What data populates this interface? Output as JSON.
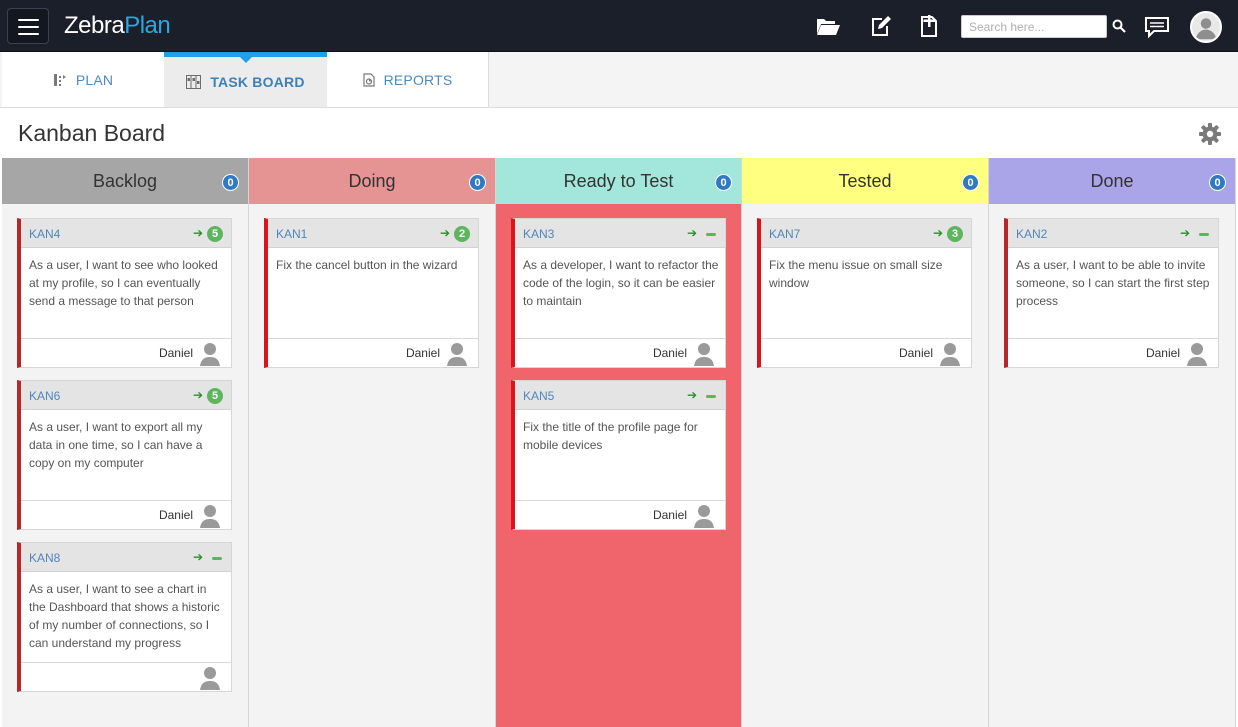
{
  "app": {
    "logo_main": "Zebra",
    "logo_accent": "Plan"
  },
  "topbar": {
    "search_placeholder": "Search here...",
    "icons": [
      "menu-icon",
      "folder-open-icon",
      "edit-icon",
      "add-document-icon",
      "search-icon",
      "comments-icon",
      "user-avatar-icon"
    ]
  },
  "tabs": [
    {
      "label": "PLAN",
      "icon": "plan-icon"
    },
    {
      "label": "TASK BOARD",
      "icon": "taskboard-icon"
    },
    {
      "label": "REPORTS",
      "icon": "reports-icon"
    }
  ],
  "board": {
    "title": "Kanban Board",
    "settings_icon": "gear-icon"
  },
  "columns": [
    {
      "name": "Backlog",
      "count": "0",
      "color": "#a6a6a6"
    },
    {
      "name": "Doing",
      "count": "0",
      "color": "#e59393"
    },
    {
      "name": "Ready to Test",
      "count": "0",
      "color": "#a3e7dc"
    },
    {
      "name": "Tested",
      "count": "0",
      "color": "#ffff80"
    },
    {
      "name": "Done",
      "count": "0",
      "color": "#aaa5e8"
    }
  ],
  "cards": {
    "kan4": {
      "id": "KAN4",
      "points": "5",
      "text": "As a user, I want to see who looked at my profile, so I can eventually send a message to that person",
      "owner": "Daniel"
    },
    "kan6": {
      "id": "KAN6",
      "points": "5",
      "text": "As a user, I want to export all my data in one time, so I can have a copy on my computer",
      "owner": "Daniel"
    },
    "kan8": {
      "id": "KAN8",
      "points": "",
      "text": "As a user, I want to see a chart in the Dashboard that shows a historic of my number of connections, so I can understand my progress",
      "owner": ""
    },
    "kan1": {
      "id": "KAN1",
      "points": "2",
      "text": "Fix the cancel button in the wizard",
      "owner": "Daniel"
    },
    "kan3": {
      "id": "KAN3",
      "points": "",
      "text": "As a developer, I want to refactor the code of the login, so it can be easier to maintain",
      "owner": "Daniel"
    },
    "kan5": {
      "id": "KAN5",
      "points": "",
      "text": "Fix the title of the profile page for mobile devices",
      "owner": "Daniel"
    },
    "kan7": {
      "id": "KAN7",
      "points": "3",
      "text": "Fix the menu issue on small size window",
      "owner": "Daniel"
    },
    "kan2": {
      "id": "KAN2",
      "points": "",
      "text": "As a user, I want to be able to invite someone, so I can start the first step process",
      "owner": "Daniel"
    }
  },
  "colors": {
    "topbar": "#1b1f2a",
    "accent": "#1ea0e6",
    "ready_to_test_highlight": "#f0656b",
    "priority_bar": "#b52728",
    "points_badge": "#5db65d",
    "count_badge": "#3079c3"
  }
}
